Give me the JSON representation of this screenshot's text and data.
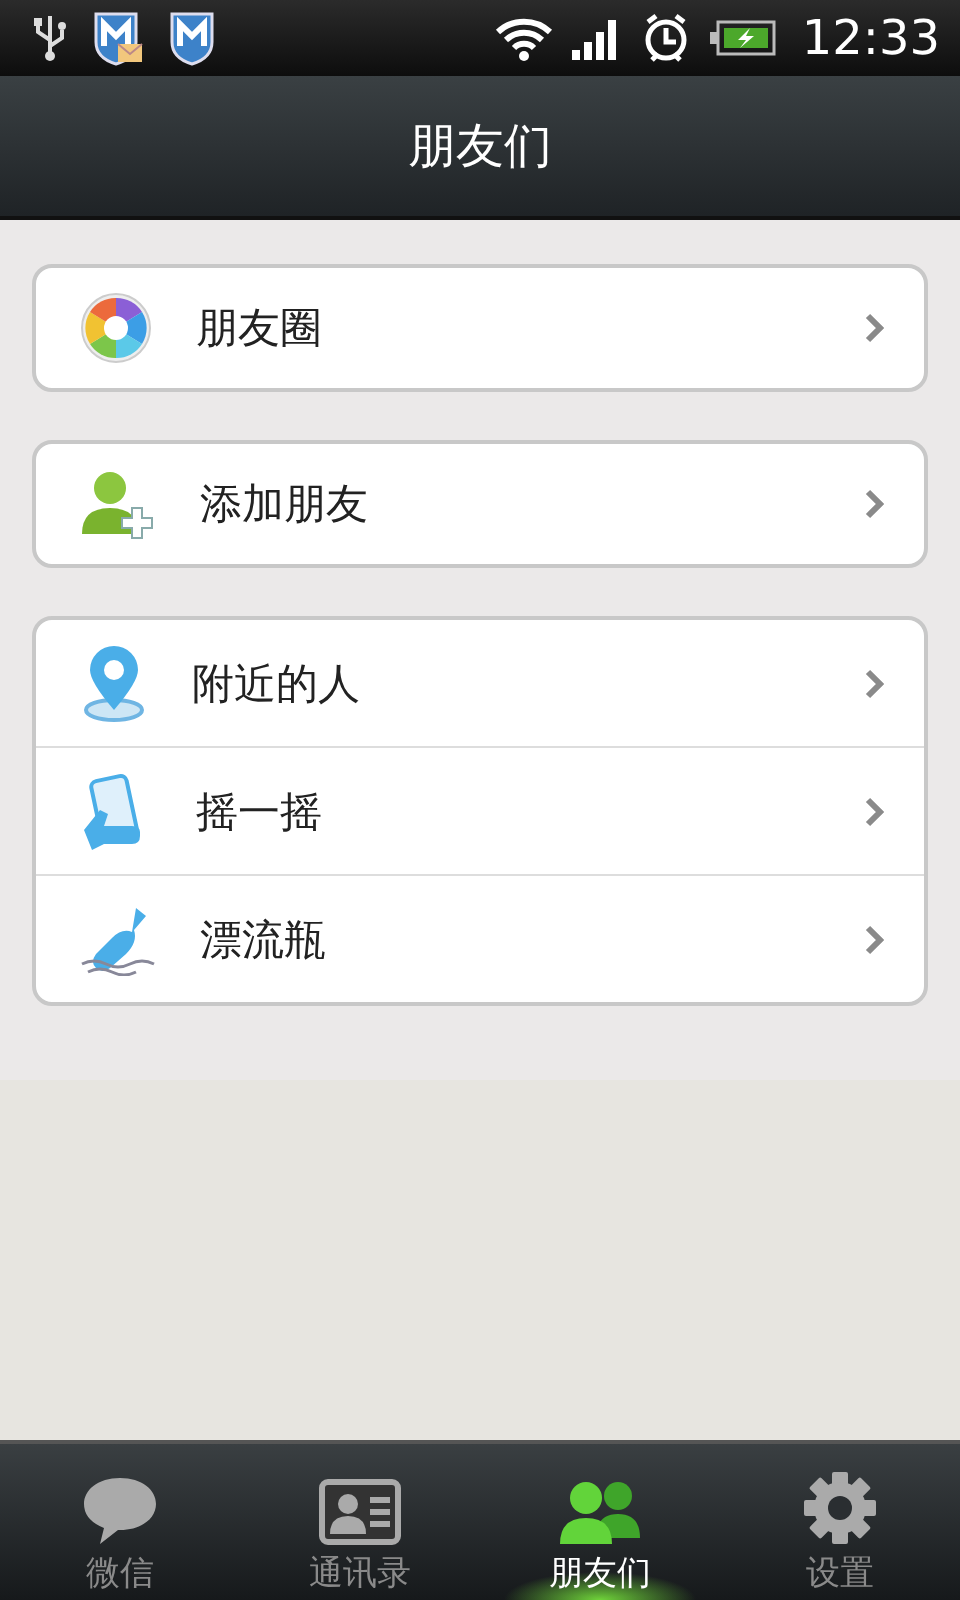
{
  "status_bar": {
    "time": "12:33",
    "battery_charging": true
  },
  "header": {
    "title": "朋友们"
  },
  "groups": [
    {
      "items": [
        {
          "label": "朋友圈",
          "kind": "moments"
        }
      ]
    },
    {
      "items": [
        {
          "label": "添加朋友",
          "kind": "add"
        }
      ]
    },
    {
      "items": [
        {
          "label": "附近的人",
          "kind": "nearby"
        },
        {
          "label": "摇一摇",
          "kind": "shake"
        },
        {
          "label": "漂流瓶",
          "kind": "bottle"
        }
      ]
    }
  ],
  "tabs": [
    {
      "label": "微信",
      "kind": "chat",
      "selected": false
    },
    {
      "label": "通讯录",
      "kind": "contacts",
      "selected": false
    },
    {
      "label": "朋友们",
      "kind": "friends",
      "selected": true
    },
    {
      "label": "设置",
      "kind": "settings",
      "selected": false
    }
  ]
}
